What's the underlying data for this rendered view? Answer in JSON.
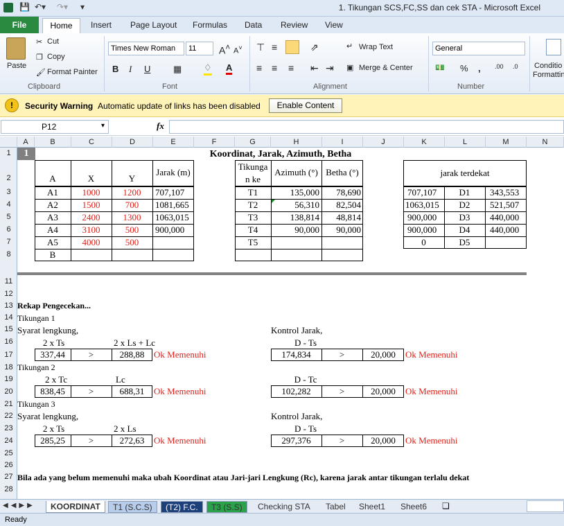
{
  "window": {
    "title": "1. Tikungan SCS,FC,SS dan cek STA  -  Microsoft Excel"
  },
  "tabs": [
    "File",
    "Home",
    "Insert",
    "Page Layout",
    "Formulas",
    "Data",
    "Review",
    "View"
  ],
  "clipboard": {
    "paste": "Paste",
    "cut": "Cut",
    "copy": "Copy",
    "format_painter": "Format Painter",
    "label": "Clipboard"
  },
  "font": {
    "name": "Times New Roman",
    "size": "11",
    "label": "Font"
  },
  "alignment": {
    "wrap": "Wrap Text",
    "merge": "Merge & Center",
    "label": "Alignment"
  },
  "number": {
    "format": "General",
    "label": "Number",
    "cond": "Conditio",
    "cond2": "Formattin"
  },
  "security": {
    "title": "Security Warning",
    "message": "Automatic update of links has been disabled",
    "button": "Enable Content"
  },
  "formula": {
    "namebox": "P12",
    "fx": "fx"
  },
  "columns": [
    "A",
    "B",
    "C",
    "D",
    "E",
    "F",
    "G",
    "H",
    "I",
    "J",
    "K",
    "L",
    "M",
    "N"
  ],
  "rows": [
    "1",
    "2",
    "3",
    "4",
    "5",
    "6",
    "7",
    "8",
    "11",
    "12",
    "13",
    "14",
    "15",
    "16",
    "17",
    "18",
    "19",
    "20",
    "21",
    "22",
    "23",
    "24",
    "25",
    "26",
    "27",
    "28"
  ],
  "sheet": {
    "a1": "1",
    "title": "Koordinat, Jarak, Azimuth, Betha",
    "hdr_a": "A",
    "hdr_x": "X",
    "hdr_y": "Y",
    "hdr_jarak": "Jarak (m)",
    "hdr_tik1": "Tikunga",
    "hdr_tik2": "n ke",
    "hdr_az": "Azimuth (°)",
    "hdr_betha": "Betha (°)",
    "hdr_dekat": "jarak terdekat",
    "t1": [
      [
        "A1",
        "1000",
        "1200",
        "707,107"
      ],
      [
        "A2",
        "1500",
        "700",
        "1081,665"
      ],
      [
        "A3",
        "2400",
        "1300",
        "1063,015"
      ],
      [
        "A4",
        "3100",
        "500",
        "900,000"
      ],
      [
        "A5",
        "4000",
        "500",
        ""
      ],
      [
        "B",
        "",
        "",
        ""
      ]
    ],
    "t2": [
      [
        "T1",
        "135,000",
        "78,690"
      ],
      [
        "T2",
        "56,310",
        "82,504"
      ],
      [
        "T3",
        "138,814",
        "48,814"
      ],
      [
        "T4",
        "90,000",
        "90,000"
      ],
      [
        "T5",
        "",
        ""
      ],
      [
        "",
        "",
        ""
      ]
    ],
    "t3": [
      [
        "707,107",
        "D1",
        "343,553"
      ],
      [
        "1063,015",
        "D2",
        "521,507"
      ],
      [
        "900,000",
        "D3",
        "440,000"
      ],
      [
        "900,000",
        "D4",
        "440,000"
      ],
      [
        "0",
        "D5",
        ""
      ]
    ],
    "rekap": "Rekap Pengecekan...",
    "tik1": "Tikungan 1",
    "tik2": "Tikungan 2",
    "tik3": "Tikungan 3",
    "syarat": "Syarat lengkung,",
    "kontrol": "Kontrol Jarak,",
    "h16a": "2 x Ts",
    "h16b": "2 x Ls + Lc",
    "h16c": "D - Ts",
    "r17": [
      "337,44",
      ">",
      "288,88",
      "Ok Memenuhi",
      "174,834",
      ">",
      "20,000",
      "Ok Memenuhi"
    ],
    "h19a": "2 x Tc",
    "h19b": "Lc",
    "h19c": "D - Tc",
    "r20": [
      "838,45",
      ">",
      "688,31",
      "Ok Memenuhi",
      "102,282",
      ">",
      "20,000",
      "Ok Memenuhi"
    ],
    "h23a": "2 x Ts",
    "h23b": "2 x Ls",
    "h23c": "D - Ts",
    "r24": [
      "285,25",
      ">",
      "272,63",
      "Ok Memenuhi",
      "297,376",
      ">",
      "20,000",
      "Ok Memenuhi"
    ],
    "note": "Bila ada yang belum memenuhi maka ubah Koordinat atau Jari-jari Lengkung (Rc), karena jarak antar tikungan terlalu dekat"
  },
  "sheettabs": [
    "KOORDINAT",
    "T1 (S.C.S)",
    "(T2) F.C.",
    "T3 (S.S)",
    "Checking STA",
    "Tabel",
    "Sheet1",
    "Sheet6"
  ],
  "status": "Ready"
}
